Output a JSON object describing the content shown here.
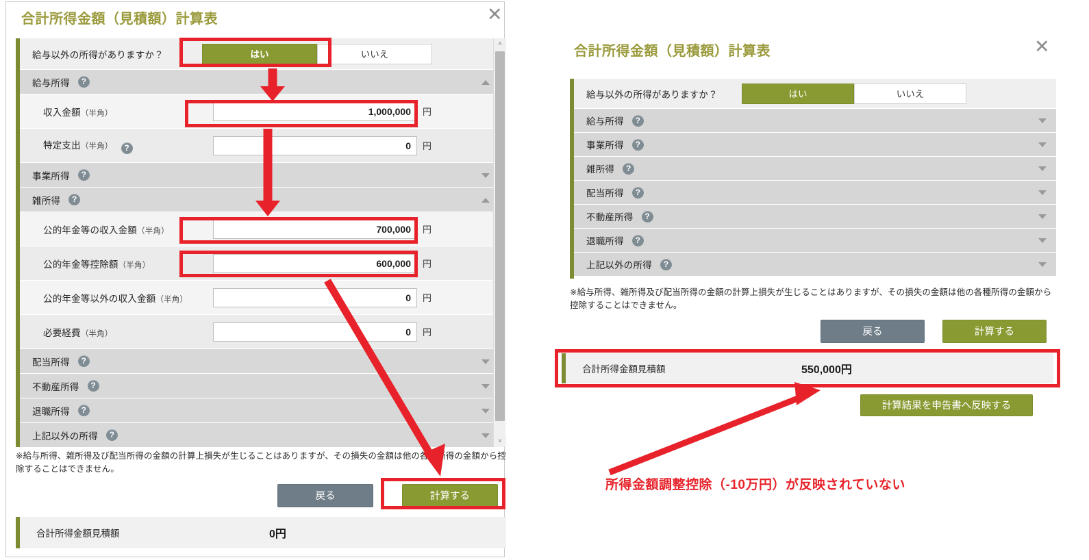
{
  "left_dialog": {
    "title": "合計所得金額（見積額）計算表",
    "close_icon": "close-icon",
    "question": {
      "label": "給与以外の所得がありますか？",
      "yes": "はい",
      "no": "いいえ",
      "selected": "はい"
    },
    "sections": [
      {
        "label": "給与所得",
        "state": "expanded",
        "help_icon": "help-icon",
        "fields": [
          {
            "label": "収入金額",
            "unit_hint": "（半角）",
            "value": "1,000,000",
            "yen": "円",
            "help": false
          },
          {
            "label": "特定支出",
            "unit_hint": "（半角）",
            "value": "0",
            "yen": "円",
            "help": true
          }
        ]
      },
      {
        "label": "事業所得",
        "state": "collapsed",
        "help_icon": "help-icon",
        "fields": []
      },
      {
        "label": "雑所得",
        "state": "expanded",
        "help_icon": "help-icon",
        "fields": [
          {
            "label": "公的年金等の収入金額",
            "unit_hint": "（半角）",
            "value": "700,000",
            "yen": "円",
            "help": false
          },
          {
            "label": "公的年金等控除額",
            "unit_hint": "（半角）",
            "value": "600,000",
            "yen": "円",
            "help": false
          },
          {
            "label": "公的年金等以外の収入金額",
            "unit_hint": "（半角）",
            "value": "0",
            "yen": "円",
            "help": false
          },
          {
            "label": "必要経費",
            "unit_hint": "（半角）",
            "value": "0",
            "yen": "円",
            "help": false
          }
        ]
      },
      {
        "label": "配当所得",
        "state": "collapsed",
        "help_icon": "help-icon",
        "fields": []
      },
      {
        "label": "不動産所得",
        "state": "collapsed",
        "help_icon": "help-icon",
        "fields": []
      },
      {
        "label": "退職所得",
        "state": "collapsed",
        "help_icon": "help-icon",
        "fields": []
      },
      {
        "label": "上記以外の所得",
        "state": "collapsed",
        "help_icon": "help-icon",
        "fields": []
      }
    ],
    "note": "※給与所得、雑所得及び配当所得の金額の計算上損失が生じることはありますが、その損失の金額は他の各種所得の金額から控除することはできません。",
    "back_button": "戻る",
    "calc_button": "計算する",
    "total_label": "合計所得金額見積額",
    "total_value": "0円",
    "scrollbar": {
      "up_arrow": "˄",
      "down_arrow": "˅"
    }
  },
  "right_dialog": {
    "title": "合計所得金額（見積額）計算表",
    "close_icon": "close-icon",
    "question": {
      "label": "給与以外の所得がありますか？",
      "yes": "はい",
      "no": "いいえ",
      "selected": "はい"
    },
    "sections": [
      {
        "label": "給与所得",
        "state": "collapsed"
      },
      {
        "label": "事業所得",
        "state": "collapsed"
      },
      {
        "label": "雑所得",
        "state": "collapsed"
      },
      {
        "label": "配当所得",
        "state": "collapsed"
      },
      {
        "label": "不動産所得",
        "state": "collapsed"
      },
      {
        "label": "退職所得",
        "state": "collapsed"
      },
      {
        "label": "上記以外の所得",
        "state": "collapsed"
      }
    ],
    "note": "※給与所得、雑所得及び配当所得の金額の計算上損失が生じることはありますが、その損失の金額は他の各種所得の金額から控除することはできません。",
    "back_button": "戻る",
    "calc_button": "計算する",
    "total_label": "合計所得金額見積額",
    "total_value": "550,000円",
    "reflect_button": "計算結果を申告書へ反映する"
  },
  "annotation": {
    "text": "所得金額調整控除（-10万円）が反映されていない",
    "color": "#e8222a"
  },
  "colors": {
    "brand_green": "#8a9a33",
    "title_green": "#9a9a3c",
    "accent_bar": "#7d8b33",
    "back_button": "#6e7d87",
    "highlight_red": "#e8222a",
    "section_row": "#d8d8d8",
    "input_row": "#f4f4f4"
  }
}
